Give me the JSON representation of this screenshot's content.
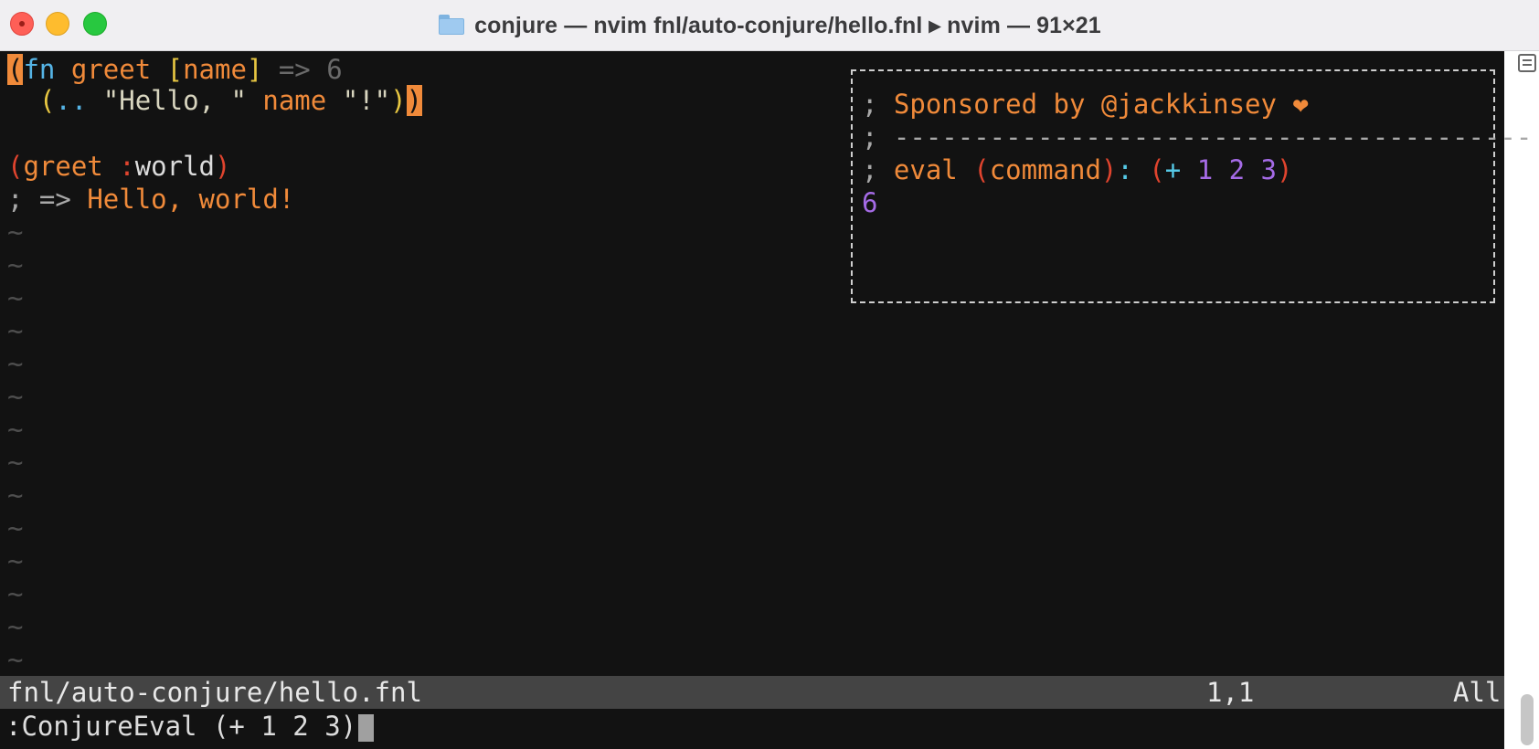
{
  "window": {
    "title": "conjure — nvim fnl/auto-conjure/hello.fnl ▸ nvim — 91×21",
    "folder_icon": "folder-icon"
  },
  "editor": {
    "line1": {
      "open_paren": "(",
      "fn": "fn",
      "name": " greet ",
      "args_open": "[",
      "arg": "name",
      "args_close": "]",
      "virtual": " => 6"
    },
    "line2": {
      "indent": "  ",
      "open_paren": "(",
      "concat": "..",
      "str1": " \"Hello, \"",
      "arg": " name",
      "str2": " \"!\"",
      "close_inner": ")",
      "close_outer": ")"
    },
    "line3": {
      "open_paren": "(",
      "fn": "greet",
      "kw_colon": " :",
      "kw": "world",
      "close_paren": ")"
    },
    "line4": {
      "comment": "; => ",
      "result": "Hello, world!"
    },
    "tilde": "~"
  },
  "hud": {
    "line1_prefix": "; ",
    "line1_text": "Sponsored by @jackkinsey ❤",
    "line2": "; ----------------------------------------",
    "line3_prefix": "; ",
    "line3_eval": "eval",
    "line3_paren_open": " (",
    "line3_cmd": "command",
    "line3_paren_close": ")",
    "line3_colon": ": ",
    "line3_expr_open": "(",
    "line3_plus": "+",
    "line3_n1": " 1",
    "line3_n2": " 2",
    "line3_n3": " 3",
    "line3_expr_close": ")",
    "result": "6"
  },
  "statusline": {
    "file": "fnl/auto-conjure/hello.fnl",
    "position": "1,1",
    "scroll": "All"
  },
  "cmdline": {
    "text": ":ConjureEval (+ 1 2 3)"
  }
}
